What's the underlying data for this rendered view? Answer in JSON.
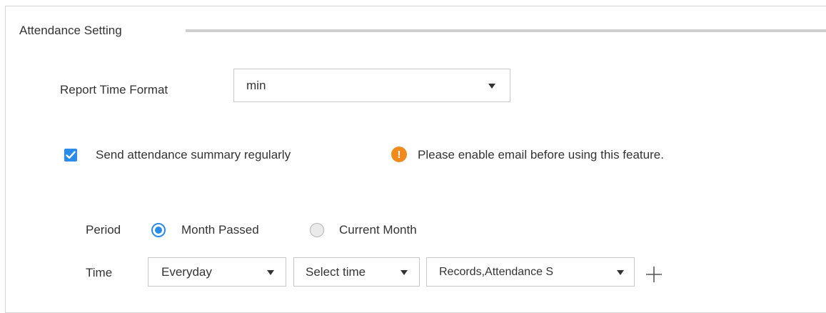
{
  "section": {
    "title": "Attendance Setting"
  },
  "report_time_format": {
    "label": "Report Time Format",
    "selected": "min"
  },
  "summary": {
    "checkbox_checked": true,
    "label": "Send attendance summary regularly",
    "warning_icon": "warning-icon",
    "warning_text": "Please enable email before using this feature."
  },
  "period": {
    "label": "Period",
    "options": [
      {
        "label": "Month Passed",
        "selected": true
      },
      {
        "label": "Current Month",
        "selected": false
      }
    ]
  },
  "time": {
    "label": "Time",
    "frequency": "Everyday",
    "time_select": "Select time",
    "content_select": "Records,Attendance S",
    "add_icon": "plus-icon"
  },
  "colors": {
    "accent": "#2a8ce8",
    "warning": "#f08a1c",
    "border": "#c8c8c8"
  }
}
